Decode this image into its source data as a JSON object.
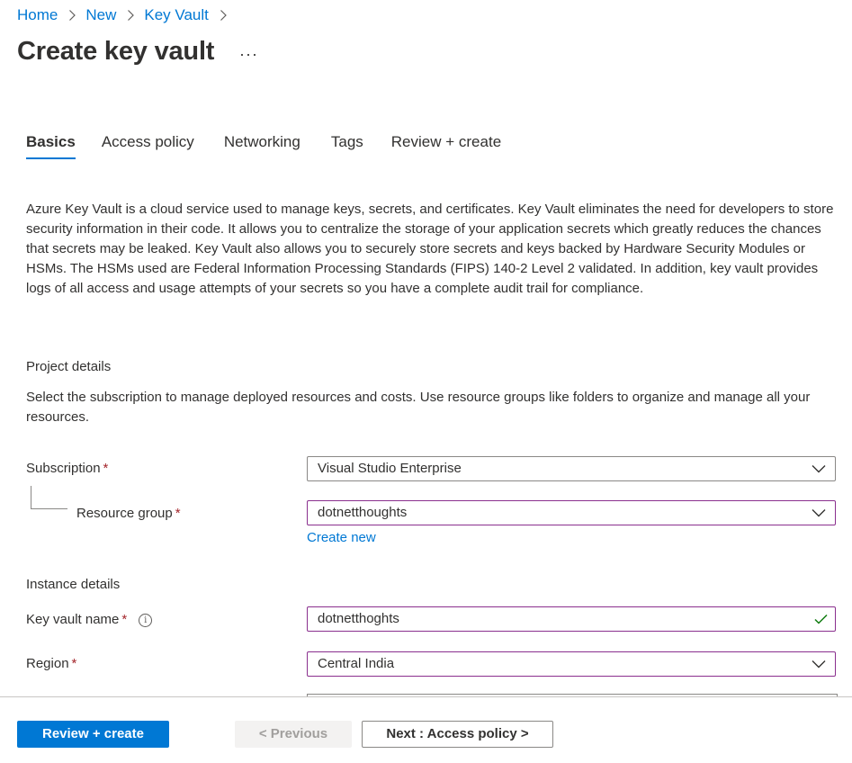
{
  "breadcrumb": [
    "Home",
    "New",
    "Key Vault"
  ],
  "page_title": "Create key vault",
  "more_label": "···",
  "tabs": [
    {
      "label": "Basics",
      "active": true
    },
    {
      "label": "Access policy",
      "active": false
    },
    {
      "label": "Networking",
      "active": false
    },
    {
      "label": "Tags",
      "active": false
    },
    {
      "label": "Review + create",
      "active": false
    }
  ],
  "intro": "Azure Key Vault is a cloud service used to manage keys, secrets, and certificates. Key Vault eliminates the need for developers to store security information in their code. It allows you to centralize the storage of your application secrets which greatly reduces the chances that secrets may be leaked. Key Vault also allows you to securely store secrets and keys backed by Hardware Security Modules or HSMs. The HSMs used are Federal Information Processing Standards (FIPS) 140-2 Level 2 validated. In addition, key vault provides logs of all access and usage attempts of your secrets so you have a complete audit trail for compliance.",
  "project": {
    "title": "Project details",
    "description": "Select the subscription to manage deployed resources and costs. Use resource groups like folders to organize and manage all your resources.",
    "subscription_label": "Subscription",
    "subscription_value": "Visual Studio Enterprise",
    "resource_group_label": "Resource group",
    "resource_group_value": "dotnetthoughts",
    "create_new": "Create new"
  },
  "instance": {
    "title": "Instance details",
    "key_vault_name_label": "Key vault name",
    "key_vault_name_value": "dotnetthoghts",
    "region_label": "Region",
    "region_value": "Central India"
  },
  "required_mark": "*",
  "info_glyph": "i",
  "footer": {
    "review_create": "Review + create",
    "previous": "< Previous",
    "next": "Next : Access policy >"
  },
  "colors": {
    "accent": "#0078d4",
    "required": "#a4262c",
    "focus_border": "#8a2f8e",
    "valid_check": "#107c10"
  },
  "icons": {
    "breadcrumb_separator": "chevron-right-icon",
    "dropdown": "chevron-down-icon",
    "valid": "checkmark-icon",
    "info": "info-icon",
    "more": "ellipsis-icon"
  }
}
